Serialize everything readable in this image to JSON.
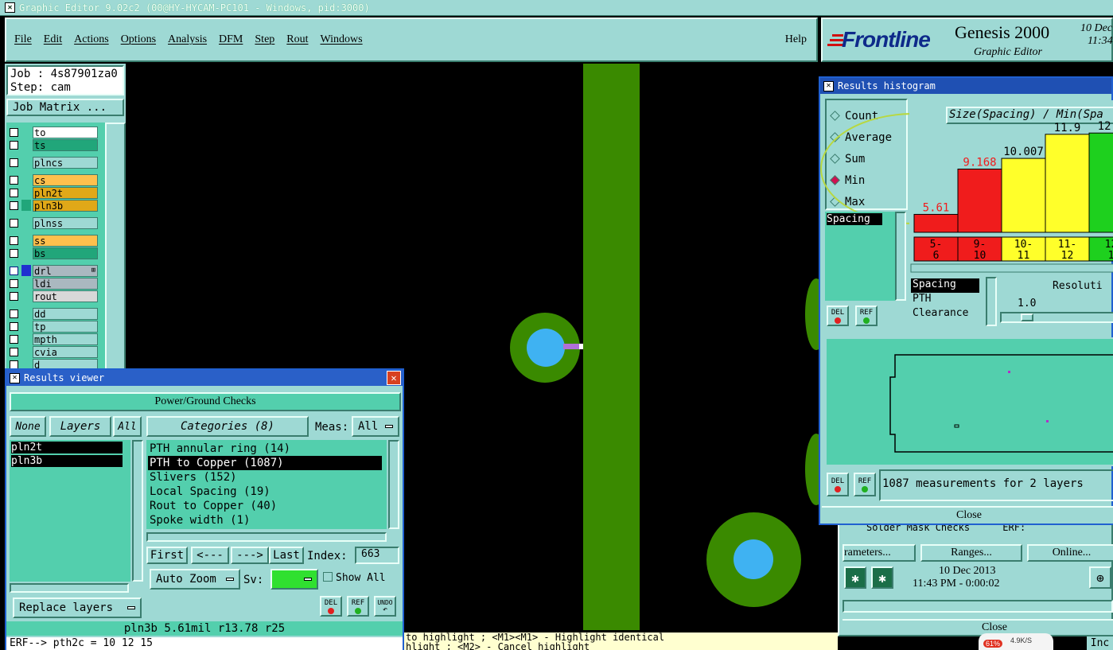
{
  "title_bar": {
    "title": "Graphic Editor 9.02c2 (00@HY-HYCAM-PC101 - Windows, pid:3000)"
  },
  "menu": {
    "items": [
      "File",
      "Edit",
      "Actions",
      "Options",
      "Analysis",
      "DFM",
      "Step",
      "Rout",
      "Windows"
    ],
    "help": "Help"
  },
  "brand": {
    "logo": "Frontline",
    "product": "Genesis 2000",
    "sub": "Graphic Editor",
    "date1": "10 Dec",
    "time1": "11:34"
  },
  "job": {
    "job": "Job : 4s87901za0",
    "step": "Step: cam",
    "matrix": "Job Matrix ..."
  },
  "layers": [
    {
      "name": "to",
      "color": "#ffffff",
      "act": false
    },
    {
      "name": "ts",
      "color": "#21a67a",
      "act": false
    },
    {
      "name": "plncs",
      "color": "#9ed9d4",
      "act": false
    },
    {
      "name": "cs",
      "color": "#ffc04d",
      "act": false
    },
    {
      "name": "pln2t",
      "color": "#e0a818",
      "act": false
    },
    {
      "name": "pln3b",
      "color": "#e0a818",
      "act": true
    },
    {
      "name": "plnss",
      "color": "#9ed9d4",
      "act": false
    },
    {
      "name": "ss",
      "color": "#ffc04d",
      "act": false
    },
    {
      "name": "bs",
      "color": "#21a67a",
      "act": false
    },
    {
      "name": "drl",
      "color": "#aab8c0",
      "act": true
    },
    {
      "name": "ldi",
      "color": "#aab8c0",
      "act": false
    },
    {
      "name": "rout",
      "color": "#d8d8d8",
      "act": false
    },
    {
      "name": "dd",
      "color": "#9ed9d4",
      "act": false
    },
    {
      "name": "tp",
      "color": "#9ed9d4",
      "act": false
    },
    {
      "name": "mpth",
      "color": "#9ed9d4",
      "act": false
    },
    {
      "name": "cvia",
      "color": "#9ed9d4",
      "act": false
    },
    {
      "name": "d",
      "color": "#9ed9d4",
      "act": false
    }
  ],
  "results_viewer": {
    "title": "Results viewer",
    "header": "Power/Ground Checks",
    "none": "None",
    "layers_btn": "Layers",
    "all": "All",
    "categories_btn": "Categories (8)",
    "meas_label": "Meas:",
    "meas_value": "All",
    "layer_list": [
      "pln2t",
      "pln3b"
    ],
    "categories": [
      "PTH annular ring (14)",
      "PTH to Copper (1087)",
      "Slivers (152)",
      "Local Spacing (19)",
      "Rout to Copper (40)",
      "Spoke width (1)"
    ],
    "first": "First",
    "prev": "<---",
    "next": "--->",
    "last": "Last",
    "index_label": "Index:",
    "index_value": "663",
    "auto_zoom": "Auto Zoom",
    "sv_label": "Sv:",
    "show_all": "Show All",
    "replace_layers": "Replace layers",
    "del": "DEL",
    "ref": "REF",
    "undo": "UNDO",
    "status": "pln3b 5.61mil r13.78 r25",
    "erf": "ERF--> pth2c = 10 12 15"
  },
  "histogram": {
    "title": "Results histogram",
    "modes": [
      "Count",
      "Average",
      "Sum",
      "Min",
      "Max"
    ],
    "selected_mode": "Min",
    "chart_title": "Size(Spacing) / Min(Spa",
    "bins": [
      {
        "range_top": "5-",
        "range_bot": "6",
        "value": "5.61",
        "num": 5.61,
        "color": "#f01c1c",
        "label_color": "#f01c1c"
      },
      {
        "range_top": "9-",
        "range_bot": "10",
        "value": "9.168",
        "num": 9.168,
        "color": "#f01c1c",
        "label_color": "#f01c1c"
      },
      {
        "range_top": "10-",
        "range_bot": "11",
        "value": "10.007",
        "num": 10.007,
        "color": "#ffff2a",
        "label_color": "#000000"
      },
      {
        "range_top": "11-",
        "range_bot": "12",
        "value": "11.9",
        "num": 11.9,
        "color": "#ffff2a",
        "label_color": "#000000"
      },
      {
        "range_top": "12",
        "range_bot": "1",
        "value": "12.0",
        "num": 12.0,
        "color": "#1ed01e",
        "label_color": "#000000"
      }
    ],
    "list_a": [
      "Spacing"
    ],
    "list_b": [
      "Spacing",
      "PTH",
      "Clearance"
    ],
    "resolution_label": "Resoluti",
    "resolution_value": "1.0",
    "measurements": "1087 measurements for 2 layers",
    "close": "Close",
    "del": "DEL",
    "ref": "REF"
  },
  "back_window": {
    "row_label": "Solder Mask Checks",
    "erf": "ERF:",
    "parameters": "rameters...",
    "ranges": "Ranges...",
    "online": "Online...",
    "date": "10 Dec 2013",
    "time": "11:43 PM - 0:00:02",
    "close": "Close"
  },
  "bottom": {
    "msg1": "to highlight ; <M1><M1> - Highlight identical",
    "msg2": "hlight ; <M2> - Cancel highlight",
    "net_pct": "61%",
    "net_speed": "4.9K/S",
    "inc": "Inc"
  }
}
